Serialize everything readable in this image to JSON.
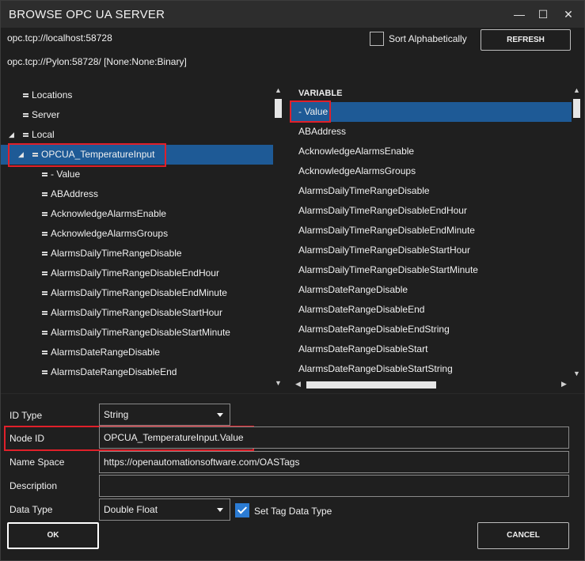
{
  "window": {
    "title": "BROWSE OPC UA SERVER",
    "minimize_glyph": "—",
    "maximize_glyph": "☐",
    "close_glyph": "✕"
  },
  "connection": {
    "url": "opc.tcp://localhost:58728",
    "endpoint": "opc.tcp://Pylon:58728/ [None:None:Binary]"
  },
  "sort": {
    "label": "Sort Alphabetically",
    "checked": false
  },
  "refresh_label": "REFRESH",
  "tree": {
    "items": [
      {
        "label": "Locations",
        "level": 1,
        "expanded": null,
        "selected": false
      },
      {
        "label": "Server",
        "level": 1,
        "expanded": null,
        "selected": false
      },
      {
        "label": "Local",
        "level": 1,
        "expanded": true,
        "selected": false
      },
      {
        "label": "OPCUA_TemperatureInput",
        "level": 2,
        "expanded": true,
        "selected": true
      },
      {
        "label": "- Value",
        "level": 3,
        "expanded": null,
        "selected": false
      },
      {
        "label": "ABAddress",
        "level": 3,
        "expanded": null,
        "selected": false
      },
      {
        "label": "AcknowledgeAlarmsEnable",
        "level": 3,
        "expanded": null,
        "selected": false
      },
      {
        "label": "AcknowledgeAlarmsGroups",
        "level": 3,
        "expanded": null,
        "selected": false
      },
      {
        "label": "AlarmsDailyTimeRangeDisable",
        "level": 3,
        "expanded": null,
        "selected": false
      },
      {
        "label": "AlarmsDailyTimeRangeDisableEndHour",
        "level": 3,
        "expanded": null,
        "selected": false
      },
      {
        "label": "AlarmsDailyTimeRangeDisableEndMinute",
        "level": 3,
        "expanded": null,
        "selected": false
      },
      {
        "label": "AlarmsDailyTimeRangeDisableStartHour",
        "level": 3,
        "expanded": null,
        "selected": false
      },
      {
        "label": "AlarmsDailyTimeRangeDisableStartMinute",
        "level": 3,
        "expanded": null,
        "selected": false
      },
      {
        "label": "AlarmsDateRangeDisable",
        "level": 3,
        "expanded": null,
        "selected": false
      },
      {
        "label": "AlarmsDateRangeDisableEnd",
        "level": 3,
        "expanded": null,
        "selected": false
      }
    ]
  },
  "variables": {
    "header": "VARIABLE",
    "items": [
      {
        "label": "- Value",
        "selected": true
      },
      {
        "label": "ABAddress",
        "selected": false
      },
      {
        "label": "AcknowledgeAlarmsEnable",
        "selected": false
      },
      {
        "label": "AcknowledgeAlarmsGroups",
        "selected": false
      },
      {
        "label": "AlarmsDailyTimeRangeDisable",
        "selected": false
      },
      {
        "label": "AlarmsDailyTimeRangeDisableEndHour",
        "selected": false
      },
      {
        "label": "AlarmsDailyTimeRangeDisableEndMinute",
        "selected": false
      },
      {
        "label": "AlarmsDailyTimeRangeDisableStartHour",
        "selected": false
      },
      {
        "label": "AlarmsDailyTimeRangeDisableStartMinute",
        "selected": false
      },
      {
        "label": "AlarmsDateRangeDisable",
        "selected": false
      },
      {
        "label": "AlarmsDateRangeDisableEnd",
        "selected": false
      },
      {
        "label": "AlarmsDateRangeDisableEndString",
        "selected": false
      },
      {
        "label": "AlarmsDateRangeDisableStart",
        "selected": false
      },
      {
        "label": "AlarmsDateRangeDisableStartString",
        "selected": false
      }
    ]
  },
  "form": {
    "id_type": {
      "label": "ID Type",
      "value": "String"
    },
    "node_id": {
      "label": "Node ID",
      "value": "OPCUA_TemperatureInput.Value"
    },
    "name_space": {
      "label": "Name Space",
      "value": "https://openautomationsoftware.com/OASTags"
    },
    "description": {
      "label": "Description",
      "value": ""
    },
    "data_type": {
      "label": "Data Type",
      "value": "Double Float"
    },
    "set_tag_data_type": {
      "label": "Set Tag Data Type",
      "checked": true
    }
  },
  "buttons": {
    "ok": "OK",
    "cancel": "CANCEL"
  },
  "colors": {
    "background": "#1f1f1f",
    "titlebar": "#2d2d2d",
    "selection": "#1e5a96",
    "highlight_outline": "#e0202a",
    "checkbox_accent": "#2b7bd3"
  }
}
